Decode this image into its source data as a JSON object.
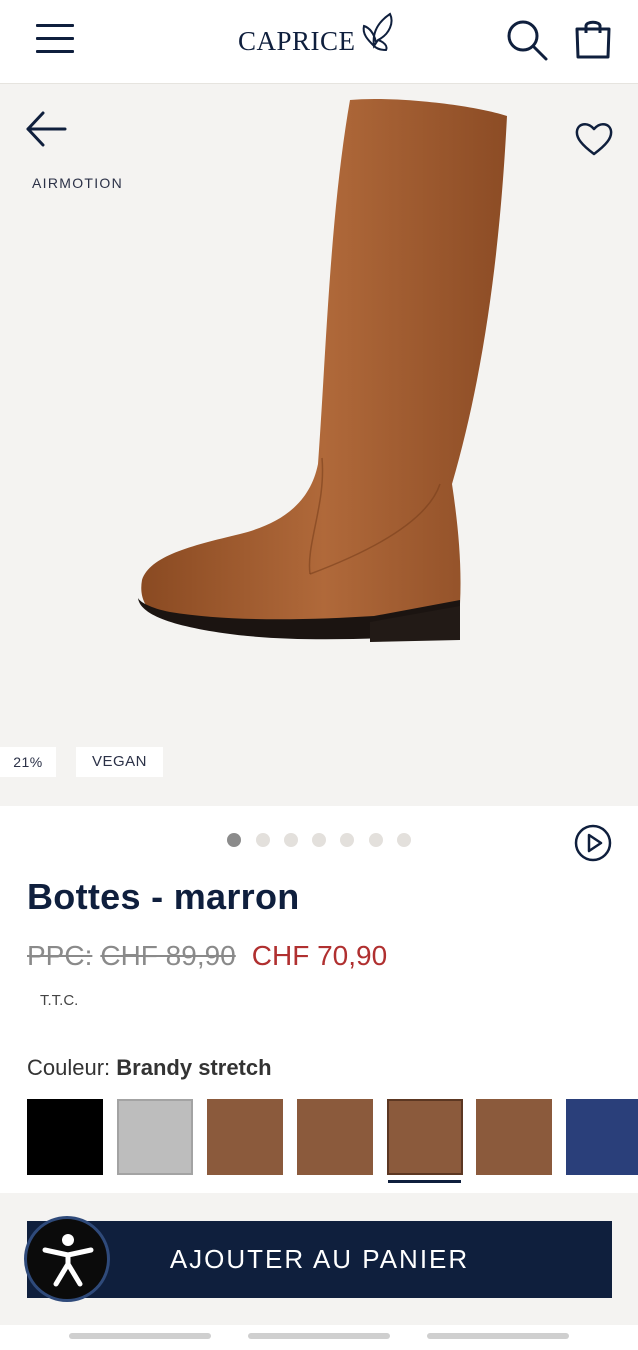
{
  "header": {
    "logo_text": "CAPRICE",
    "icons": [
      "menu-icon",
      "butterfly-icon",
      "search-icon",
      "shopping-bag-icon"
    ]
  },
  "gallery": {
    "brand_tag": "AIRMOTION",
    "badges": {
      "discount": "21%",
      "vegan": "VEGAN"
    },
    "image_count": 7,
    "active_image": 1,
    "icons": [
      "back-arrow-icon",
      "heart-icon",
      "play-video-icon"
    ]
  },
  "product": {
    "title": "Bottes - marron",
    "ppc_label": "PPC:",
    "old_price": "CHF 89,90",
    "new_price": "CHF 70,90",
    "tax_note": "T.T.C.",
    "color_label": "Couleur:",
    "color_value": "Brandy stretch",
    "swatches": [
      {
        "color": "#000000",
        "selected": false
      },
      {
        "color": "#bdbdbd",
        "selected": false
      },
      {
        "color": "#8b5a3c",
        "selected": false
      },
      {
        "color": "#8b5a3c",
        "selected": false
      },
      {
        "color": "#8b5a3c",
        "selected": true
      },
      {
        "color": "#8b5a3c",
        "selected": false
      },
      {
        "color": "#2a3f7a",
        "selected": false
      }
    ]
  },
  "cart": {
    "add_label": "AJOUTER AU PANIER"
  },
  "colors": {
    "navy": "#0f1f3d",
    "sale_red": "#b03030",
    "gallery_bg": "#f4f3f1"
  }
}
